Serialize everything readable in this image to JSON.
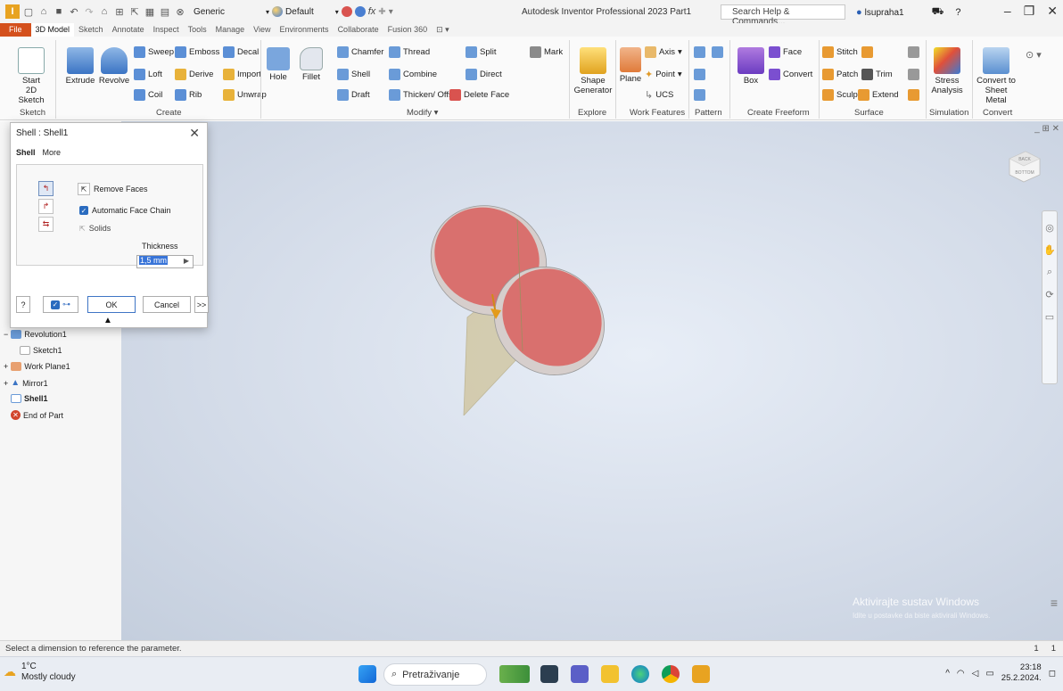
{
  "window": {
    "title": "Autodesk Inventor Professional 2023   Part1",
    "search_placeholder": "Search Help & Commands...",
    "user": "lsupraha1",
    "appearance_combo": "Generic",
    "material_combo": "Default"
  },
  "menu": {
    "tabs": [
      "File",
      "3D Model",
      "Sketch",
      "Annotate",
      "Inspect",
      "Tools",
      "Manage",
      "View",
      "Environments",
      "Collaborate",
      "Fusion 360"
    ]
  },
  "ribbon": {
    "sketch": {
      "start": "Start",
      "sketch2d": "2D Sketch",
      "panel": "Sketch"
    },
    "create": {
      "extrude": "Extrude",
      "revolve": "Revolve",
      "sweep": "Sweep",
      "loft": "Loft",
      "coil": "Coil",
      "emboss": "Emboss",
      "derive": "Derive",
      "rib": "Rib",
      "decal": "Decal",
      "import": "Import",
      "unwrap": "Unwrap",
      "panel": "Create"
    },
    "modify": {
      "hole": "Hole",
      "fillet": "Fillet",
      "chamfer": "Chamfer",
      "shell": "Shell",
      "draft": "Draft",
      "thread": "Thread",
      "combine": "Combine",
      "thicken": "Thicken/ Offset",
      "split": "Split",
      "direct": "Direct",
      "delete_face": "Delete Face",
      "mark": "Mark",
      "panel": "Modify ▾"
    },
    "explore": {
      "shape": "Shape",
      "generator": "Generator",
      "panel": "Explore"
    },
    "work": {
      "plane": "Plane",
      "axis": "Axis",
      "point": "Point",
      "ucs": "UCS",
      "panel": "Work Features"
    },
    "pattern": {
      "panel": "Pattern"
    },
    "freeform": {
      "box": "Box",
      "face": "Face",
      "convert": "Convert",
      "panel": "Create Freeform"
    },
    "surface": {
      "stitch": "Stitch",
      "patch": "Patch",
      "sculpt": "Sculpt",
      "trim": "Trim",
      "extend": "Extend",
      "panel": "Surface"
    },
    "simulation": {
      "stress": "Stress",
      "analysis": "Analysis",
      "panel": "Simulation"
    },
    "convert": {
      "to": "Convert to",
      "sheet": "Sheet Metal",
      "panel": "Convert"
    }
  },
  "browser": {
    "nodes": [
      "Revolution1",
      "Sketch1",
      "Work Plane1",
      "Mirror1",
      "Shell1",
      "End of Part"
    ]
  },
  "dialog": {
    "title": "Shell : Shell1",
    "tabs": [
      "Shell",
      "More"
    ],
    "remove_faces": "Remove Faces",
    "auto_chain": "Automatic Face Chain",
    "solids": "Solids",
    "thickness_label": "Thickness",
    "thickness_value": "1,5 mm",
    "ok": "OK",
    "cancel": "Cancel",
    "more": ">>"
  },
  "viewport": {
    "viewcube_labels": [
      "BACK",
      "BOTTOM"
    ],
    "watermark_title": "Aktivirajte sustav Windows",
    "watermark_sub": "Idite u postavke da biste aktivirali Windows."
  },
  "status": {
    "message": "Select a dimension to reference the parameter.",
    "n1": "1",
    "n2": "1"
  },
  "taskbar": {
    "temp": "1°C",
    "weather": "Mostly cloudy",
    "search": "Pretraživanje",
    "time": "23:18",
    "date": "25.2.2024."
  },
  "colors": {
    "file_tab": "#d4501c",
    "shell_inner": "#d9706e",
    "shell_outer": "#cfc4c2",
    "work_plane": "#cfc39a"
  }
}
